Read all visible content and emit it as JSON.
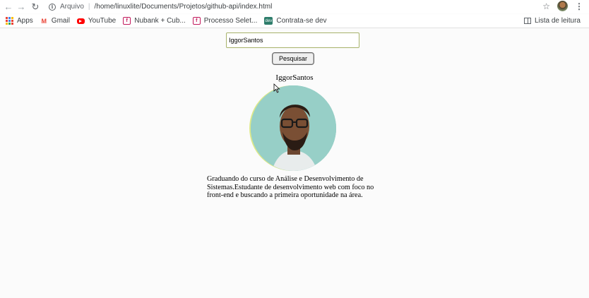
{
  "browser": {
    "address": {
      "security_label": "Arquivo",
      "url": "/home/linuxlite/Documents/Projetos/github-api/index.html"
    },
    "bookmarks": [
      {
        "label": "Apps",
        "icon": "apps-grid-icon"
      },
      {
        "label": "Gmail",
        "icon": "gmail-icon"
      },
      {
        "label": "YouTube",
        "icon": "youtube-icon"
      },
      {
        "label": "Nubank + Cub...",
        "icon": "nubank-icon"
      },
      {
        "label": "Processo Selet...",
        "icon": "bookmark-page-icon"
      },
      {
        "label": "Contrata-se dev",
        "icon": "contrata-se-dev-icon"
      }
    ],
    "reading_list_label": "Lista de leitura"
  },
  "page": {
    "search": {
      "value": "IggorSantos",
      "button_label": "Pesquisar"
    },
    "profile": {
      "username": "IggorSantos",
      "bio": "Graduando do curso de Análise e Desenvolvimento de Sistemas.Estudante de desenvolvimento web com foco no front-end e buscando a primeira oportunidade na área."
    }
  },
  "colors": {
    "input_border": "#a7b26a",
    "avatar_bg": "#8fcbc3",
    "avatar_ring": "#dde98c"
  }
}
